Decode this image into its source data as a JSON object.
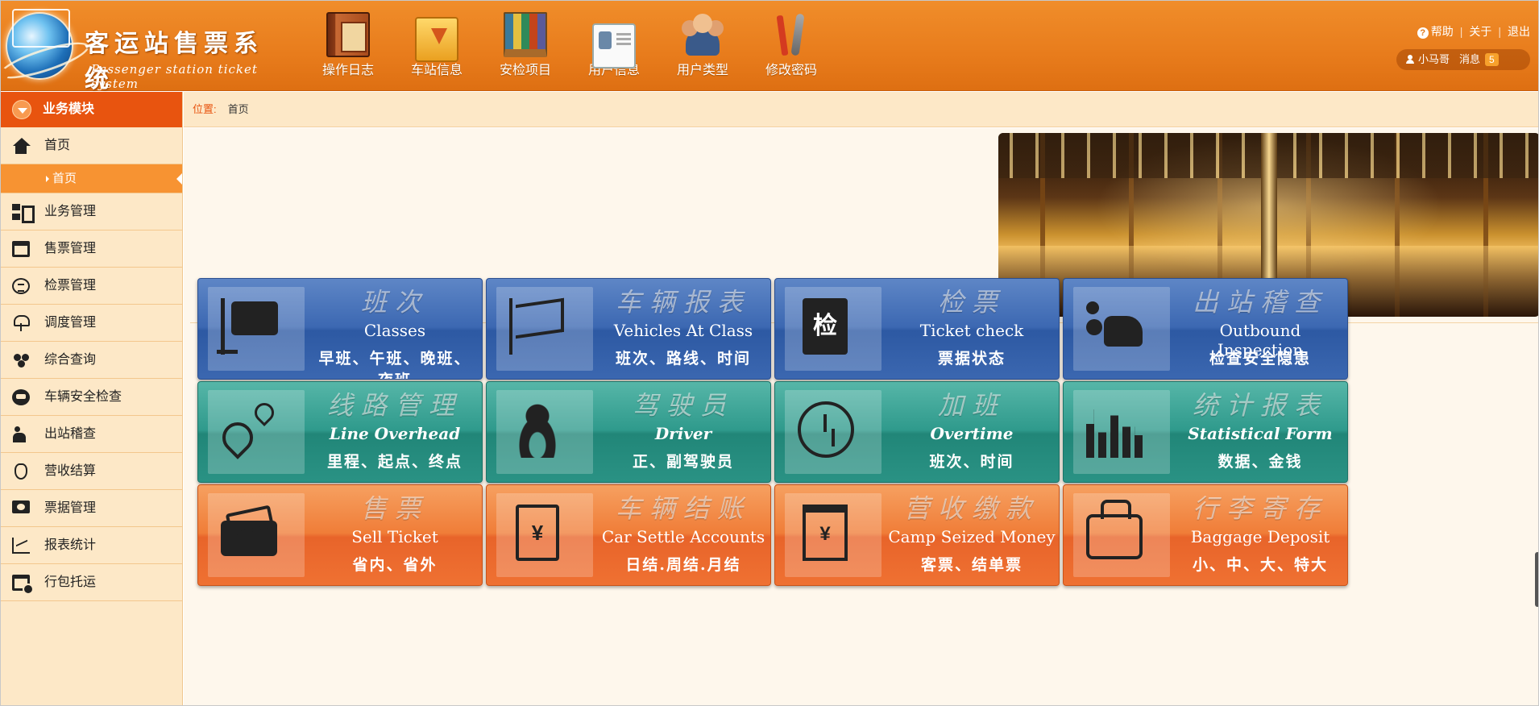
{
  "app": {
    "title_cn": "客运站售票系统",
    "title_en": "Passenger station ticket system"
  },
  "topnav": [
    {
      "label": "操作日志",
      "icon": "log-book-icon"
    },
    {
      "label": "车站信息",
      "icon": "station-folder-icon"
    },
    {
      "label": "安检项目",
      "icon": "security-books-icon"
    },
    {
      "label": "用户信息",
      "icon": "user-card-icon"
    },
    {
      "label": "用户类型",
      "icon": "user-group-icon"
    },
    {
      "label": "修改密码",
      "icon": "tools-icon"
    }
  ],
  "toplinks": {
    "help": "帮助",
    "about": "关于",
    "logout": "退出"
  },
  "user": {
    "name": "小马哥",
    "messages_label": "消息",
    "messages_count": "5"
  },
  "sidebar": {
    "header": "业务模块",
    "items": [
      {
        "label": "首页",
        "icon": "home-icon"
      },
      {
        "label": "业务管理",
        "icon": "business-icon"
      },
      {
        "label": "售票管理",
        "icon": "ticket-sale-icon"
      },
      {
        "label": "检票管理",
        "icon": "ticket-check-icon"
      },
      {
        "label": "调度管理",
        "icon": "dispatch-icon"
      },
      {
        "label": "综合查询",
        "icon": "query-icon"
      },
      {
        "label": "车辆安全检查",
        "icon": "vehicle-safety-icon"
      },
      {
        "label": "出站稽查",
        "icon": "outbound-inspect-icon"
      },
      {
        "label": "营收结算",
        "icon": "revenue-icon"
      },
      {
        "label": "票据管理",
        "icon": "bill-icon"
      },
      {
        "label": "报表统计",
        "icon": "report-icon"
      },
      {
        "label": "行包托运",
        "icon": "baggage-icon"
      }
    ],
    "sub_active": "首页"
  },
  "breadcrumb": {
    "lead": "位置:",
    "current": "首页"
  },
  "banner": {
    "slides": 7,
    "active": 0
  },
  "tiles": [
    {
      "t1": "班次",
      "t2": "Classes",
      "t3": "早班、午班、晚班、夜班",
      "color": "blue",
      "icon": "classes-icon"
    },
    {
      "t1": "车辆报表",
      "t2": "Vehicles At Class",
      "t3": "班次、路线、时间",
      "color": "blue",
      "icon": "vehicle-report-icon"
    },
    {
      "t1": "检票",
      "t2": "Ticket check",
      "t3": "票据状态",
      "color": "blue",
      "icon": "ticket-check-doc-icon",
      "glyph": "检"
    },
    {
      "t1": "出站稽查",
      "t2": "Outbound Inspection",
      "t3": "检查安全隐患",
      "color": "blue",
      "icon": "inspection-icon"
    },
    {
      "t1": "线路管理",
      "t2": "Line Overhead",
      "t3": "里程、起点、终点",
      "color": "teal",
      "icon": "route-icon"
    },
    {
      "t1": "驾驶员",
      "t2": "Driver",
      "t3": "正、副驾驶员",
      "color": "teal",
      "icon": "driver-icon"
    },
    {
      "t1": "加班",
      "t2": "Overtime",
      "t3": "班次、时间",
      "color": "teal",
      "icon": "overtime-icon"
    },
    {
      "t1": "统计报表",
      "t2": "Statistical Form",
      "t3": "数据、金钱",
      "color": "teal",
      "icon": "statistics-icon"
    },
    {
      "t1": "售票",
      "t2": "Sell Ticket",
      "t3": "省内、省外",
      "color": "orange",
      "icon": "sell-ticket-icon"
    },
    {
      "t1": "车辆结账",
      "t2": "Car Settle Accounts",
      "t3": "日结.周结.月结",
      "color": "orange",
      "icon": "settle-accounts-icon",
      "glyph": "¥"
    },
    {
      "t1": "营收缴款",
      "t2": "Camp Seized Money",
      "t3": "客票、结单票",
      "color": "orange",
      "icon": "revenue-payment-icon",
      "glyph": "¥"
    },
    {
      "t1": "行李寄存",
      "t2": "Baggage Deposit",
      "t3": "小、中、大、特大",
      "color": "orange",
      "icon": "baggage-deposit-icon"
    }
  ]
}
